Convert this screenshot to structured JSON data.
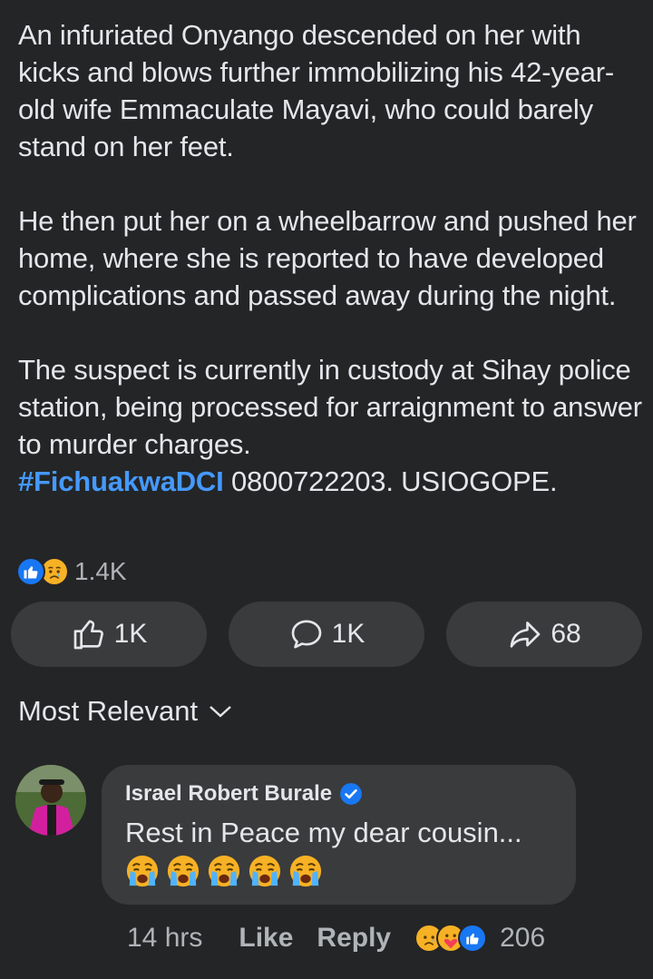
{
  "post": {
    "paragraph_1": "An infuriated Onyango descended on her with kicks and blows further immobilizing his 42-year-old wife Emmaculate Mayavi, who could barely stand on her feet.",
    "paragraph_2": "He then put her on a wheelbarrow and pushed her home, where she is reported to have developed complications and passed away during the night.",
    "paragraph_3": "The suspect is currently in custody at Sihay police station, being processed for arraignment to answer to murder charges.",
    "hashtag": "#FichuakwaDCI",
    "paragraph_3_tail": " 0800722203. USIOGOPE."
  },
  "reactions": {
    "icons": [
      "like-icon",
      "sad-icon"
    ],
    "count": "1.4K"
  },
  "actions": {
    "like_count": "1K",
    "comment_count": "1K",
    "share_count": "68"
  },
  "comments_sort": {
    "label": "Most Relevant"
  },
  "comment": {
    "author": "Israel Robert Burale",
    "verified": true,
    "text": "Rest in Peace my dear cousin...",
    "emoji_count": 5,
    "time": "14 hrs",
    "like_label": "Like",
    "reply_label": "Reply",
    "reaction_icons": [
      "sad-icon",
      "care-icon",
      "like-icon"
    ],
    "reaction_count": "206"
  },
  "colors": {
    "background": "#242526",
    "surface": "#3a3b3c",
    "text": "#e4e6eb",
    "muted": "#b0b3b8",
    "link": "#4599ff",
    "like_blue": "#1877f2"
  }
}
